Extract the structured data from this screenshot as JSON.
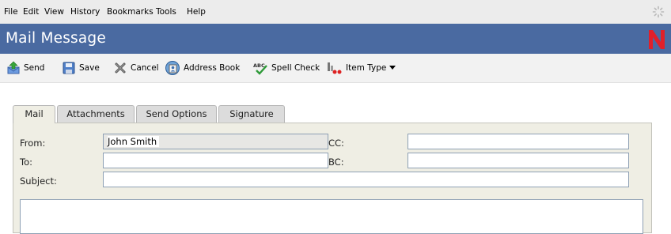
{
  "menubar": {
    "items": [
      {
        "label": "File"
      },
      {
        "label": "Edit"
      },
      {
        "label": "View"
      },
      {
        "label": "History"
      },
      {
        "label": "Bookmarks"
      },
      {
        "label": "Tools"
      },
      {
        "label": "Help"
      }
    ]
  },
  "titlebar": {
    "title": "Mail Message",
    "brand_color": "#e0202a",
    "background": "#4a6aa1"
  },
  "toolbar": {
    "send": "Send",
    "save": "Save",
    "cancel": "Cancel",
    "address_book": "Address Book",
    "spell_check": "Spell Check",
    "item_type": "Item Type"
  },
  "tabs": {
    "items": [
      {
        "label": "Mail",
        "active": true
      },
      {
        "label": "Attachments",
        "active": false
      },
      {
        "label": "Send Options",
        "active": false
      },
      {
        "label": "Signature",
        "active": false
      }
    ]
  },
  "form": {
    "from_label": "From:",
    "from_value": "John Smith",
    "to_label": "To:",
    "to_value": "",
    "cc_label": "CC:",
    "cc_value": "",
    "bc_label": "BC:",
    "bc_value": "",
    "subject_label": "Subject:",
    "subject_value": "",
    "body_value": ""
  }
}
